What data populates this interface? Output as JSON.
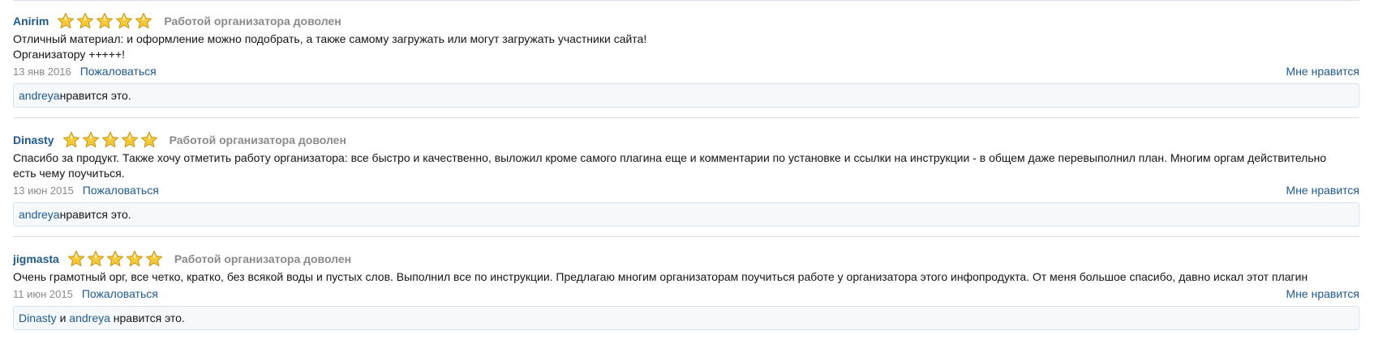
{
  "reviews": [
    {
      "author": "Anirim",
      "stars": 5,
      "rating_text": "Работой организатора доволен",
      "text_lines": [
        "Отличный материал: и оформление можно подобрать, а также самому загружать или могут загружать участники сайта!",
        "Организатору +++++!"
      ],
      "date": "13 янв 2016",
      "report_label": "Пожаловаться",
      "like_label": "Мне нравится",
      "likes": {
        "users": [
          "andreya"
        ],
        "conjunction": "",
        "suffix": " нравится это."
      }
    },
    {
      "author": "Dinasty",
      "stars": 5,
      "rating_text": "Работой организатора доволен",
      "text_lines": [
        "Спасибо за продукт. Также хочу отметить работу организатора: все быстро и качественно, выложил кроме самого плагина еще и комментарии по установке и ссылки на инструкции - в общем даже перевыполнил план. Многим оргам действительно есть чему поучиться."
      ],
      "date": "13 июн 2015",
      "report_label": "Пожаловаться",
      "like_label": "Мне нравится",
      "likes": {
        "users": [
          "andreya"
        ],
        "conjunction": "",
        "suffix": " нравится это."
      }
    },
    {
      "author": "jigmasta",
      "stars": 5,
      "rating_text": "Работой организатора доволен",
      "text_lines": [
        "Очень грамотный орг, все четко, кратко, без всякой воды и пустых слов. Выполнил все по инструкции. Предлагаю многим организаторам поучиться работе у организатора этого инфопродукта. От меня большое спасибо, давно искал этот плагин"
      ],
      "date": "11 июн 2015",
      "report_label": "Пожаловаться",
      "like_label": "Мне нравится",
      "likes": {
        "users": [
          "Dinasty",
          "andreya"
        ],
        "conjunction": " и ",
        "suffix": " нравится это."
      }
    }
  ],
  "colors": {
    "link": "#1f5a8c",
    "muted": "#8a8a8a",
    "star_fill": "#f6c93a",
    "star_stroke": "#c89a1e",
    "likes_bg": "#f5f9fc"
  },
  "icons": {
    "star": "star-icon"
  }
}
